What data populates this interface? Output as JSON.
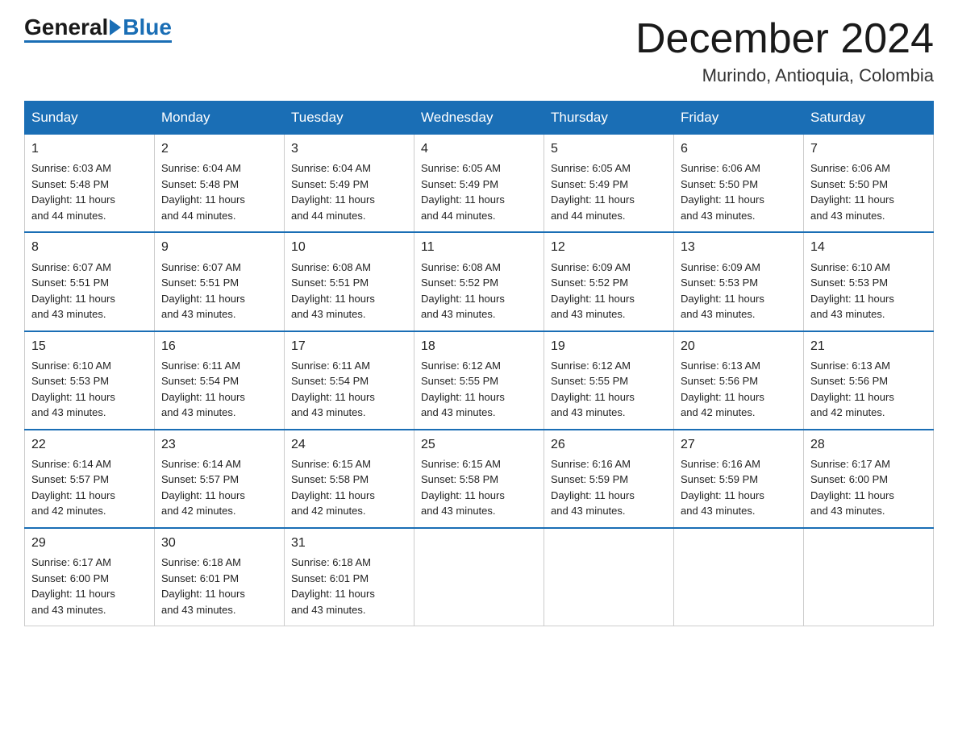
{
  "logo": {
    "general": "General",
    "blue": "Blue"
  },
  "title": "December 2024",
  "location": "Murindo, Antioquia, Colombia",
  "days_of_week": [
    "Sunday",
    "Monday",
    "Tuesday",
    "Wednesday",
    "Thursday",
    "Friday",
    "Saturday"
  ],
  "weeks": [
    [
      {
        "day": "1",
        "sunrise": "6:03 AM",
        "sunset": "5:48 PM",
        "daylight": "11 hours and 44 minutes."
      },
      {
        "day": "2",
        "sunrise": "6:04 AM",
        "sunset": "5:48 PM",
        "daylight": "11 hours and 44 minutes."
      },
      {
        "day": "3",
        "sunrise": "6:04 AM",
        "sunset": "5:49 PM",
        "daylight": "11 hours and 44 minutes."
      },
      {
        "day": "4",
        "sunrise": "6:05 AM",
        "sunset": "5:49 PM",
        "daylight": "11 hours and 44 minutes."
      },
      {
        "day": "5",
        "sunrise": "6:05 AM",
        "sunset": "5:49 PM",
        "daylight": "11 hours and 44 minutes."
      },
      {
        "day": "6",
        "sunrise": "6:06 AM",
        "sunset": "5:50 PM",
        "daylight": "11 hours and 43 minutes."
      },
      {
        "day": "7",
        "sunrise": "6:06 AM",
        "sunset": "5:50 PM",
        "daylight": "11 hours and 43 minutes."
      }
    ],
    [
      {
        "day": "8",
        "sunrise": "6:07 AM",
        "sunset": "5:51 PM",
        "daylight": "11 hours and 43 minutes."
      },
      {
        "day": "9",
        "sunrise": "6:07 AM",
        "sunset": "5:51 PM",
        "daylight": "11 hours and 43 minutes."
      },
      {
        "day": "10",
        "sunrise": "6:08 AM",
        "sunset": "5:51 PM",
        "daylight": "11 hours and 43 minutes."
      },
      {
        "day": "11",
        "sunrise": "6:08 AM",
        "sunset": "5:52 PM",
        "daylight": "11 hours and 43 minutes."
      },
      {
        "day": "12",
        "sunrise": "6:09 AM",
        "sunset": "5:52 PM",
        "daylight": "11 hours and 43 minutes."
      },
      {
        "day": "13",
        "sunrise": "6:09 AM",
        "sunset": "5:53 PM",
        "daylight": "11 hours and 43 minutes."
      },
      {
        "day": "14",
        "sunrise": "6:10 AM",
        "sunset": "5:53 PM",
        "daylight": "11 hours and 43 minutes."
      }
    ],
    [
      {
        "day": "15",
        "sunrise": "6:10 AM",
        "sunset": "5:53 PM",
        "daylight": "11 hours and 43 minutes."
      },
      {
        "day": "16",
        "sunrise": "6:11 AM",
        "sunset": "5:54 PM",
        "daylight": "11 hours and 43 minutes."
      },
      {
        "day": "17",
        "sunrise": "6:11 AM",
        "sunset": "5:54 PM",
        "daylight": "11 hours and 43 minutes."
      },
      {
        "day": "18",
        "sunrise": "6:12 AM",
        "sunset": "5:55 PM",
        "daylight": "11 hours and 43 minutes."
      },
      {
        "day": "19",
        "sunrise": "6:12 AM",
        "sunset": "5:55 PM",
        "daylight": "11 hours and 43 minutes."
      },
      {
        "day": "20",
        "sunrise": "6:13 AM",
        "sunset": "5:56 PM",
        "daylight": "11 hours and 42 minutes."
      },
      {
        "day": "21",
        "sunrise": "6:13 AM",
        "sunset": "5:56 PM",
        "daylight": "11 hours and 42 minutes."
      }
    ],
    [
      {
        "day": "22",
        "sunrise": "6:14 AM",
        "sunset": "5:57 PM",
        "daylight": "11 hours and 42 minutes."
      },
      {
        "day": "23",
        "sunrise": "6:14 AM",
        "sunset": "5:57 PM",
        "daylight": "11 hours and 42 minutes."
      },
      {
        "day": "24",
        "sunrise": "6:15 AM",
        "sunset": "5:58 PM",
        "daylight": "11 hours and 42 minutes."
      },
      {
        "day": "25",
        "sunrise": "6:15 AM",
        "sunset": "5:58 PM",
        "daylight": "11 hours and 43 minutes."
      },
      {
        "day": "26",
        "sunrise": "6:16 AM",
        "sunset": "5:59 PM",
        "daylight": "11 hours and 43 minutes."
      },
      {
        "day": "27",
        "sunrise": "6:16 AM",
        "sunset": "5:59 PM",
        "daylight": "11 hours and 43 minutes."
      },
      {
        "day": "28",
        "sunrise": "6:17 AM",
        "sunset": "6:00 PM",
        "daylight": "11 hours and 43 minutes."
      }
    ],
    [
      {
        "day": "29",
        "sunrise": "6:17 AM",
        "sunset": "6:00 PM",
        "daylight": "11 hours and 43 minutes."
      },
      {
        "day": "30",
        "sunrise": "6:18 AM",
        "sunset": "6:01 PM",
        "daylight": "11 hours and 43 minutes."
      },
      {
        "day": "31",
        "sunrise": "6:18 AM",
        "sunset": "6:01 PM",
        "daylight": "11 hours and 43 minutes."
      },
      null,
      null,
      null,
      null
    ]
  ],
  "labels": {
    "sunrise": "Sunrise:",
    "sunset": "Sunset:",
    "daylight": "Daylight:"
  }
}
